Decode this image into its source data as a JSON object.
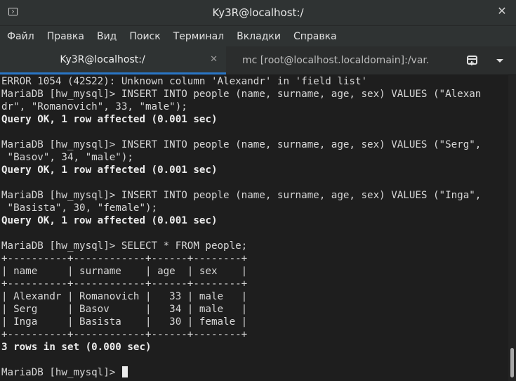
{
  "window": {
    "title": "Ky3R@localhost:/"
  },
  "menu": {
    "items": [
      "Файл",
      "Правка",
      "Вид",
      "Поиск",
      "Терминал",
      "Вкладки",
      "Справка"
    ]
  },
  "tabs": [
    {
      "label": "Ky3R@localhost:/",
      "active": true
    },
    {
      "label": "mc [root@localhost.localdomain]:/var...",
      "active": false
    }
  ],
  "icons": {
    "window_icon": "terminal-icon",
    "close": "close-icon",
    "new_tab": "new-tab-icon",
    "tab_menu": "chevron-down-icon"
  },
  "colors": {
    "accent": "#2a76c6",
    "terminal_bg": "#1e1e1e",
    "terminal_fg": "#d8d8d8"
  },
  "terminal": {
    "lines": [
      {
        "text": "ERROR 1054 (42S22): Unknown column 'Alexandr' in 'field list'",
        "bold": false
      },
      {
        "text": "MariaDB [hw_mysql]> INSERT INTO people (name, surname, age, sex) VALUES (\"Alexan",
        "bold": false
      },
      {
        "text": "dr\", \"Romanovich\", 33, \"male\");",
        "bold": false
      },
      {
        "text": "Query OK, 1 row affected (0.001 sec)",
        "bold": true
      },
      {
        "text": "",
        "bold": false
      },
      {
        "text": "MariaDB [hw_mysql]> INSERT INTO people (name, surname, age, sex) VALUES (\"Serg\",",
        "bold": false
      },
      {
        "text": " \"Basov\", 34, \"male\");",
        "bold": false
      },
      {
        "text": "Query OK, 1 row affected (0.001 sec)",
        "bold": true
      },
      {
        "text": "",
        "bold": false
      },
      {
        "text": "MariaDB [hw_mysql]> INSERT INTO people (name, surname, age, sex) VALUES (\"Inga\",",
        "bold": false
      },
      {
        "text": " \"Basista\", 30, \"female\");",
        "bold": false
      },
      {
        "text": "Query OK, 1 row affected (0.001 sec)",
        "bold": true
      },
      {
        "text": "",
        "bold": false
      },
      {
        "text": "MariaDB [hw_mysql]> SELECT * FROM people;",
        "bold": false
      },
      {
        "text": "+----------+------------+------+--------+",
        "bold": false
      },
      {
        "text": "| name     | surname    | age  | sex    |",
        "bold": false
      },
      {
        "text": "+----------+------------+------+--------+",
        "bold": false
      },
      {
        "text": "| Alexandr | Romanovich |   33 | male   |",
        "bold": false
      },
      {
        "text": "| Serg     | Basov      |   34 | male   |",
        "bold": false
      },
      {
        "text": "| Inga     | Basista    |   30 | female |",
        "bold": false
      },
      {
        "text": "+----------+------------+------+--------+",
        "bold": false
      },
      {
        "text": "3 rows in set (0.000 sec)",
        "bold": true
      },
      {
        "text": "",
        "bold": false
      },
      {
        "text": "MariaDB [hw_mysql]> ",
        "bold": false,
        "cursor": true
      }
    ]
  },
  "scrollbar": {
    "position": 0.97
  }
}
